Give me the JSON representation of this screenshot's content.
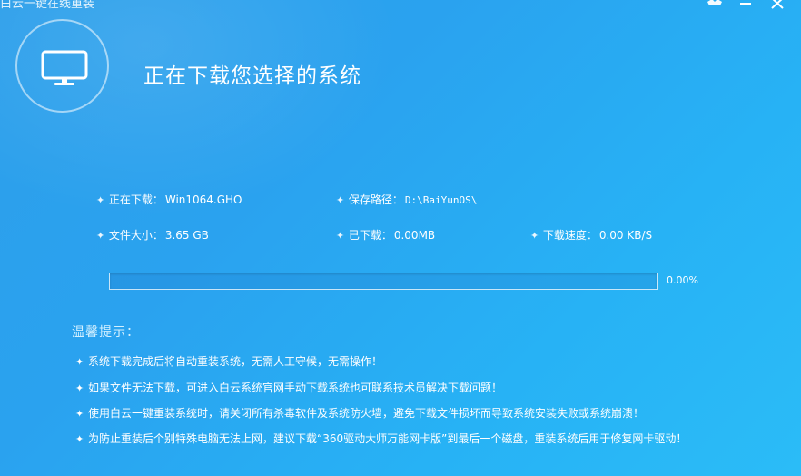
{
  "window": {
    "app_title": "白云一键在线重装",
    "page_title": "正在下载您选择的系统"
  },
  "info": {
    "downloading_label": "正在下载：",
    "downloading_value": "Win1064.GHO",
    "save_path_label": "保存路径：",
    "save_path_value": "D:\\BaiYunOS\\",
    "file_size_label": "文件大小：",
    "file_size_value": "3.65 GB",
    "downloaded_label": "已下载：",
    "downloaded_value": "0.00MB",
    "speed_label": "下载速度：",
    "speed_value": "0.00 KB/S"
  },
  "progress": {
    "fraction": 0.0,
    "text": "0.00%"
  },
  "tips": {
    "heading": "温馨提示：",
    "items": [
      "系统下载完成后将自动重装系统，无需人工守候，无需操作！",
      "如果文件无法下载，可进入白云系统官网手动下载系统也可联系技术员解决下载问题！",
      "使用白云一键重装系统时，请关闭所有杀毒软件及系统防火墙，避免下载文件损坏而导致系统安装失败或系统崩溃！",
      "为防止重装后个别特殊电脑无法上网，建议下载“360驱动大师万能网卡版”到最后一个磁盘，重装系统后用于修复网卡驱动！"
    ]
  },
  "icons": {
    "monitor": "monitor-icon",
    "skin": "skin-icon",
    "minimize": "minimize-icon",
    "close": "close-icon",
    "bullet": "✦"
  },
  "colors": {
    "background": "#2aa2ef",
    "progress_fill": "#7fd0ff",
    "tips_heading": "#d3f0ff"
  }
}
